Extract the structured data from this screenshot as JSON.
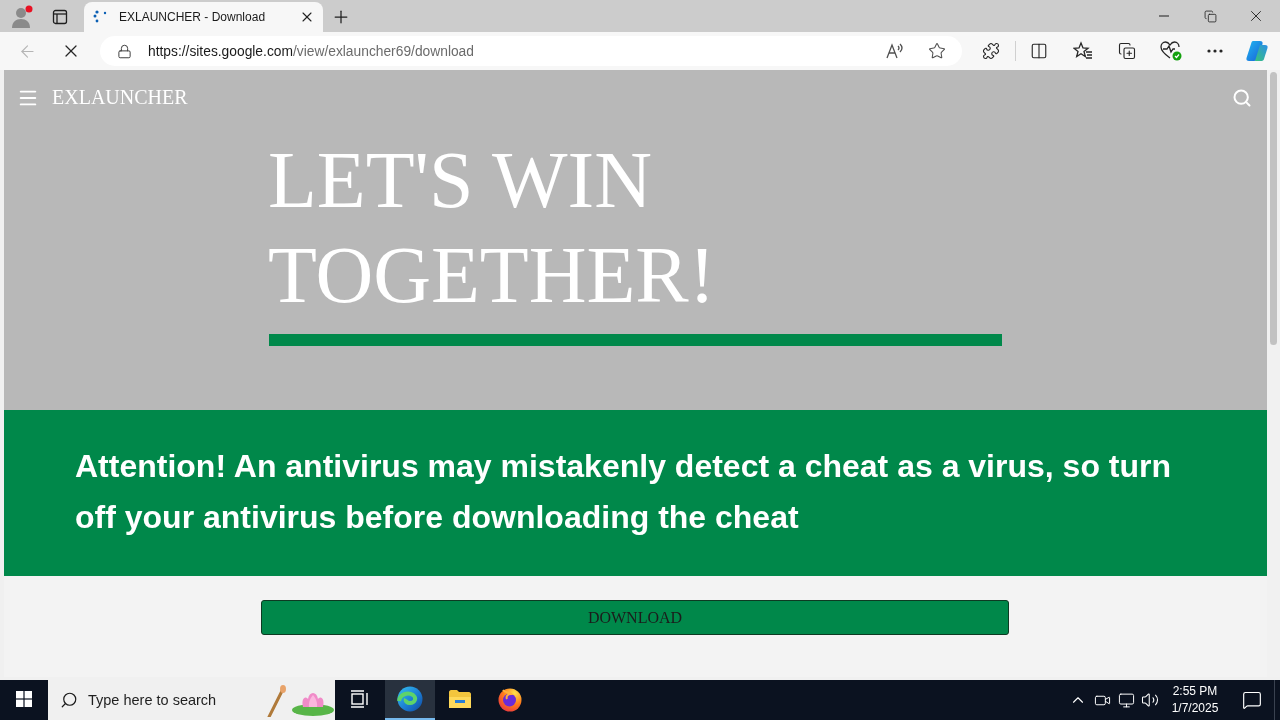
{
  "browser": {
    "tabs": [
      {
        "title": "EXLAUNCHER - Download",
        "selected": true,
        "loading": true
      }
    ],
    "back_disabled": true,
    "address_bar": {
      "url_host": "https://sites.google.com",
      "url_path": "/view/exlauncher69/download"
    }
  },
  "page": {
    "site_title": "EXLAUNCHER",
    "hero_heading": "LET'S WIN TOGETHER!",
    "notice": "Attention! An antivirus may mistakenly detect a cheat as a virus, so turn off your antivirus before downloading the cheat",
    "download_button": "DOWNLOAD"
  },
  "taskbar": {
    "search": {
      "placeholder": "Type here to search"
    },
    "apps": [
      {
        "kind": "browser",
        "active": true
      },
      {
        "kind": "folder",
        "active": false
      },
      {
        "kind": "firefox",
        "active": false
      }
    ],
    "clock": {
      "time": "2:55 PM",
      "date": "1/7/2025"
    }
  }
}
